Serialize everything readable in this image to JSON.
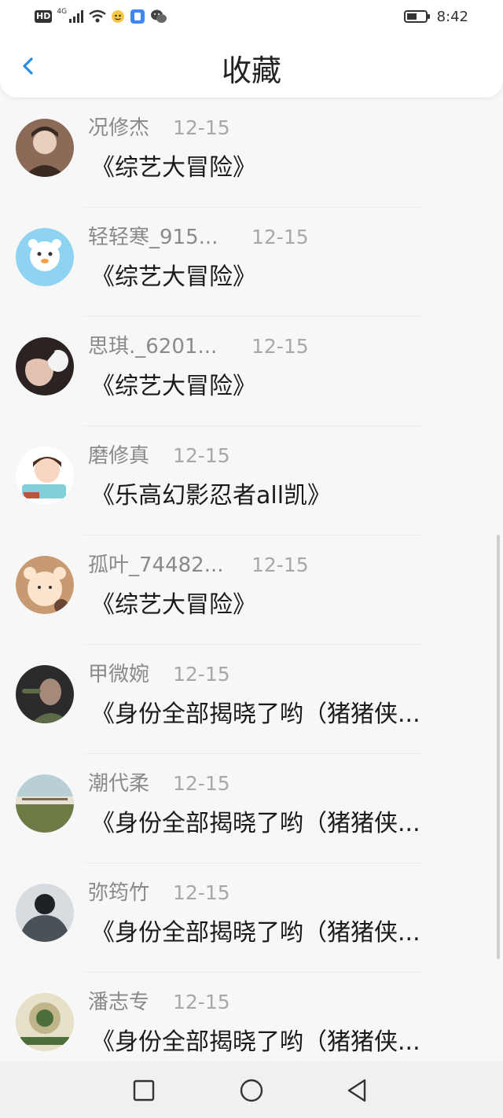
{
  "status_bar": {
    "hd_label": "HD",
    "network_label": "4G",
    "time": "8:42",
    "icons": [
      "signal-icon",
      "wifi-icon",
      "app-notification-icon",
      "app-notification-icon",
      "wechat-icon",
      "battery-icon"
    ]
  },
  "header": {
    "title": "收藏",
    "back_icon": "chevron-left-icon",
    "accent_color": "#2a8ee8"
  },
  "favorites": [
    {
      "name": "况修杰",
      "date": "12-15",
      "work": "《综艺大冒险》",
      "avatar_colors": [
        "#8c6a58",
        "#e8d0bd",
        "#3b2a22"
      ]
    },
    {
      "name": "轻轻寒_915...",
      "date": "12-15",
      "work": "《综艺大冒险》",
      "avatar_colors": [
        "#8fd3f2",
        "#ffffff",
        "#f4a24a"
      ]
    },
    {
      "name": "思琪._6201...",
      "date": "12-15",
      "work": "《综艺大冒险》",
      "avatar_colors": [
        "#2b2322",
        "#e3c2b2",
        "#f3f3f3"
      ]
    },
    {
      "name": "磨修真",
      "date": "12-15",
      "work": "《乐高幻影忍者all凯》",
      "avatar_colors": [
        "#ffffff",
        "#4a2c1e",
        "#7fd0d8"
      ]
    },
    {
      "name": "孤叶_74482...",
      "date": "12-15",
      "work": "《综艺大冒险》",
      "avatar_colors": [
        "#c89a72",
        "#fde4cf",
        "#6a4634"
      ]
    },
    {
      "name": "甲微婉",
      "date": "12-15",
      "work": "《身份全部揭晓了哟（猪猪侠...",
      "avatar_colors": [
        "#2b2b2b",
        "#a58a7a",
        "#5d6b4a"
      ]
    },
    {
      "name": "潮代柔",
      "date": "12-15",
      "work": "《身份全部揭晓了哟（猪猪侠...",
      "avatar_colors": [
        "#b8cfd6",
        "#e7e2d4",
        "#6d7c46"
      ]
    },
    {
      "name": "弥筠竹",
      "date": "12-15",
      "work": "《身份全部揭晓了哟（猪猪侠...",
      "avatar_colors": [
        "#d7dce0",
        "#4a5258",
        "#1e2226"
      ]
    },
    {
      "name": "潘志专",
      "date": "12-15",
      "work": "《身份全部揭晓了哟（猪猪侠...",
      "avatar_colors": [
        "#e6e0c8",
        "#4c6e3a",
        "#c0b48a"
      ]
    }
  ],
  "nav_bar": {
    "recent_icon": "square-recents-icon",
    "home_icon": "circle-home-icon",
    "back_icon": "triangle-back-icon"
  }
}
